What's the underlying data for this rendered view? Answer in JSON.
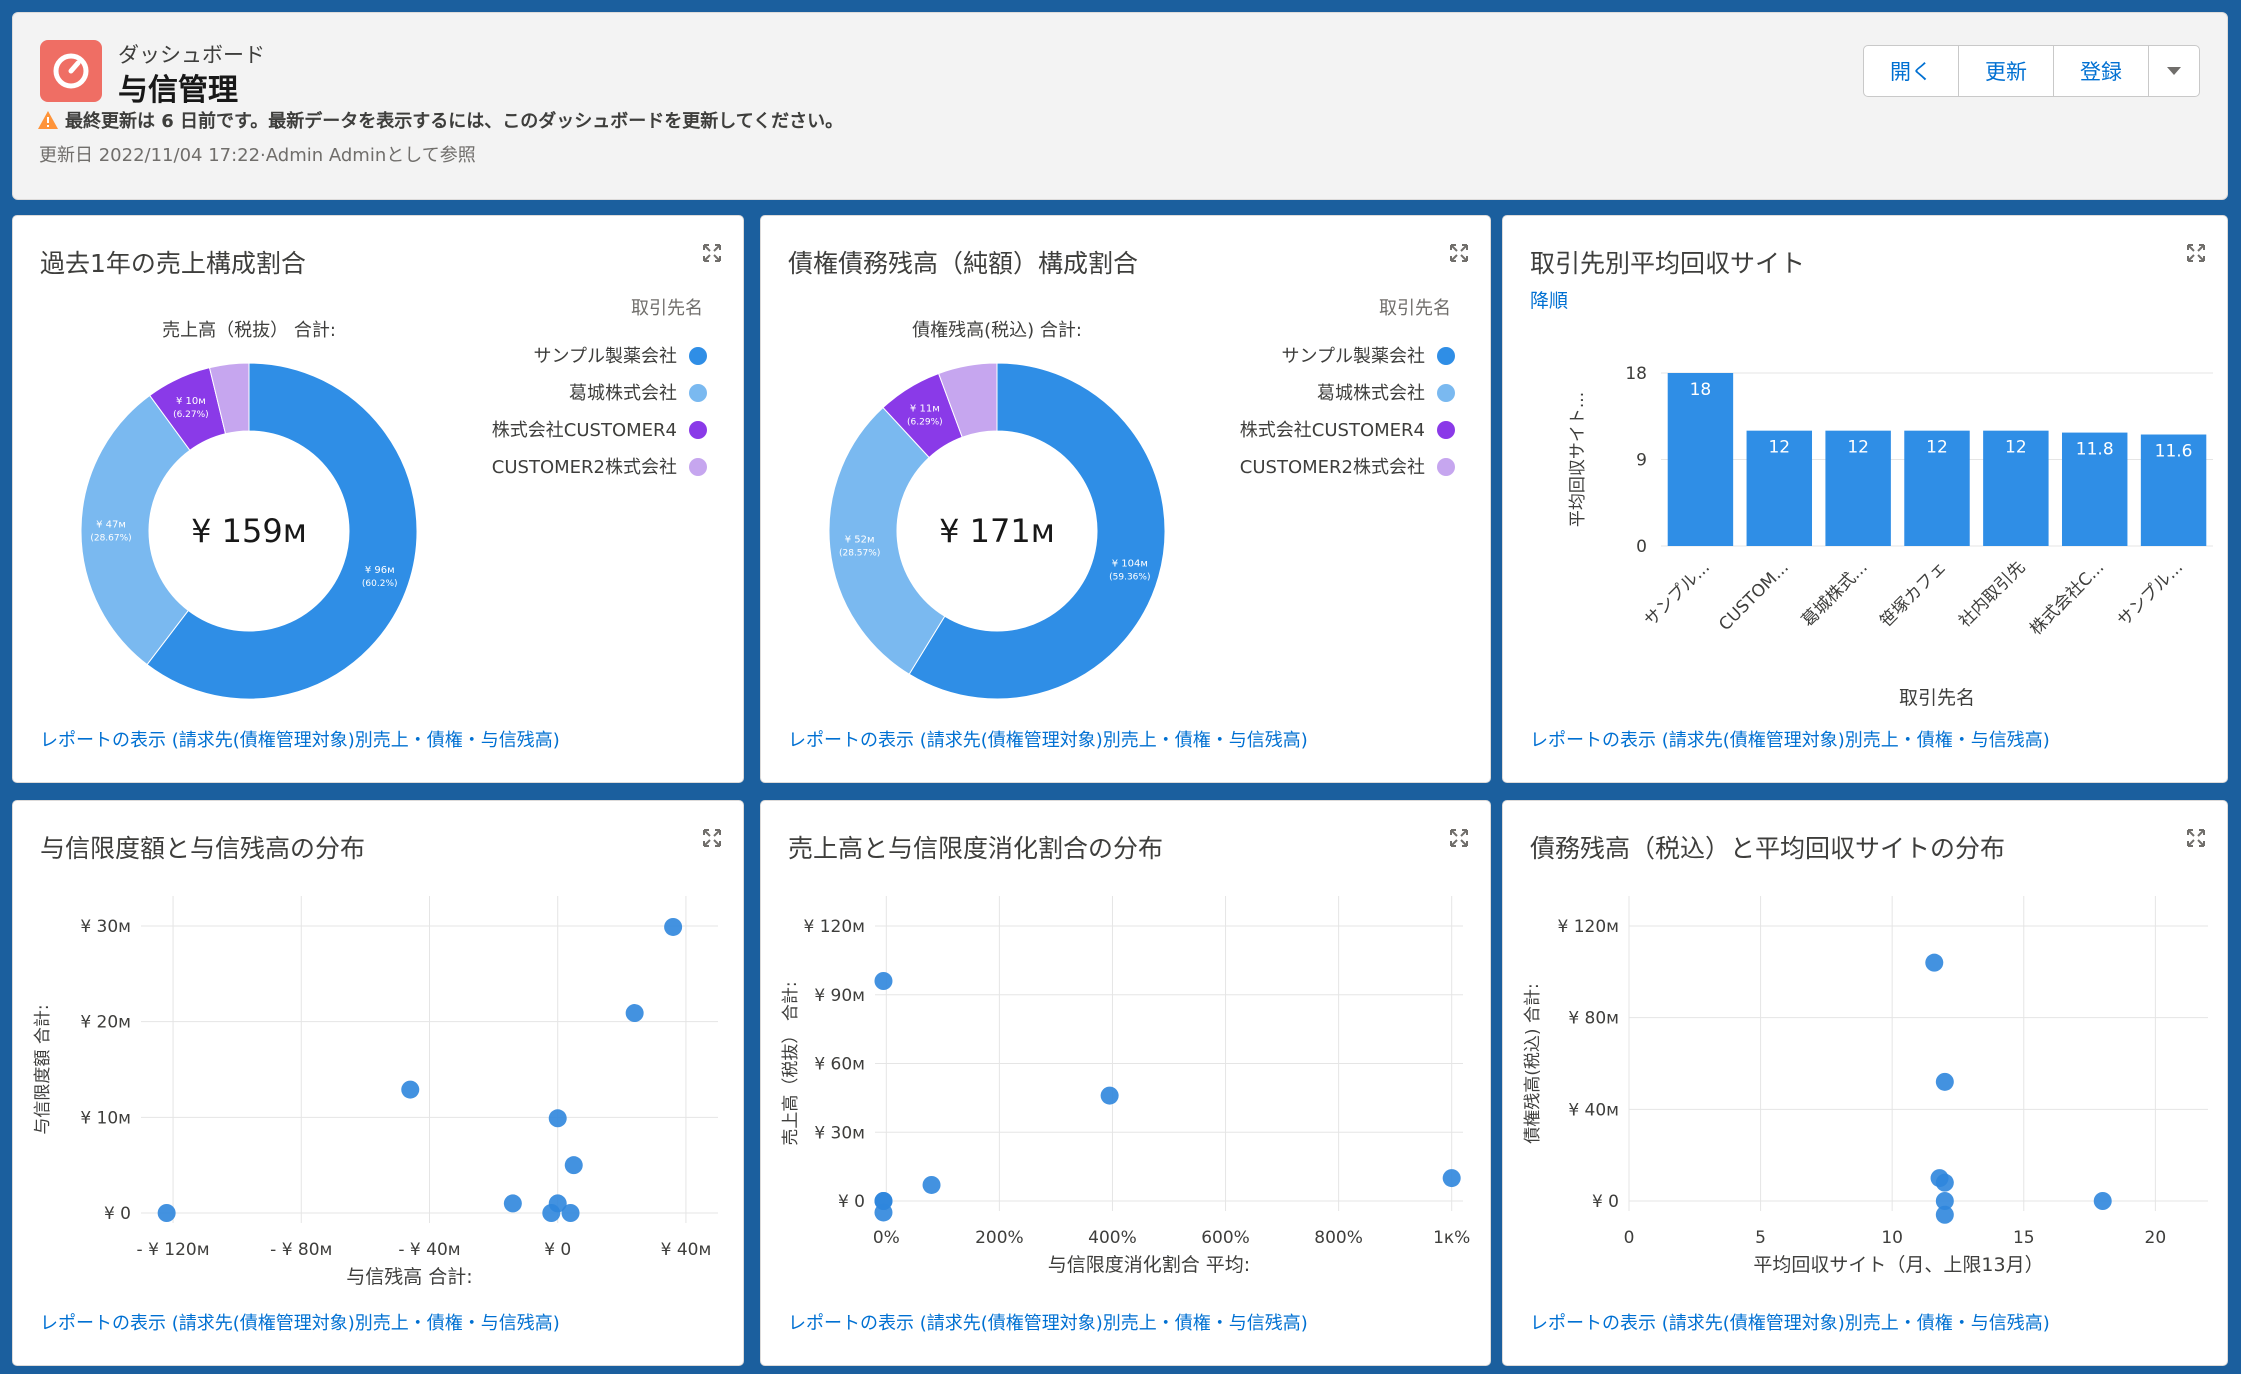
{
  "header": {
    "eyebrow": "ダッシュボード",
    "title": "与信管理",
    "warning": "最終更新は 6 日前です。最新データを表示するには、このダッシュボードを更新してください。",
    "updated": "更新日 2022/11/04 17:22·Admin Adminとして参照",
    "buttons": {
      "open": "開く",
      "refresh": "更新",
      "subscribe": "登録"
    }
  },
  "colors": {
    "c1": "#2f8ee6",
    "c2": "#7ab9f0",
    "c3": "#8a3ae8",
    "c4": "#c6a6ef",
    "bar": "#2f8ee6",
    "point": "#2f86dd",
    "link": "#0070d2"
  },
  "cards": {
    "c1": {
      "title": "過去1年の売上構成割合",
      "link": "レポートの表示 (請求先(債権管理対象)別売上・債権・与信残高)"
    },
    "c2": {
      "title": "債権債務残高（純額）構成割合",
      "link": "レポートの表示 (請求先(債権管理対象)別売上・債権・与信残高)"
    },
    "c3": {
      "title": "取引先別平均回収サイト",
      "subtitle": "降順",
      "link": "レポートの表示 (請求先(債権管理対象)別売上・債権・与信残高)"
    },
    "c4": {
      "title": "与信限度額と与信残高の分布",
      "link": "レポートの表示 (請求先(債権管理対象)別売上・債権・与信残高)"
    },
    "c5": {
      "title": "売上高と与信限度消化割合の分布",
      "link": "レポートの表示 (請求先(債権管理対象)別売上・債権・与信残高)"
    },
    "c6": {
      "title": "債務残高（税込）と平均回収サイトの分布",
      "link": "レポートの表示 (請求先(債権管理対象)別売上・債権・与信残高)"
    }
  },
  "chart_data": [
    {
      "type": "pie",
      "subtype": "donut",
      "measure": "売上高（税抜） 合計:",
      "center": "¥ 159м",
      "legend_title": "取引先名",
      "legend_placement": "right",
      "series": [
        {
          "name": "サンプル製薬会社",
          "value": 96,
          "label": "¥ 96м",
          "pct": "(60.2%)"
        },
        {
          "name": "葛城株式会社",
          "value": 47,
          "label": "¥ 47м",
          "pct": "(28.67%)"
        },
        {
          "name": "株式会社CUSTOMER4",
          "value": 10,
          "label": "¥ 10м",
          "pct": "(6.27%)"
        },
        {
          "name": "CUSTOMER2株式会社",
          "value": 6,
          "label": "",
          "pct": ""
        }
      ]
    },
    {
      "type": "pie",
      "subtype": "donut",
      "measure": "債権残高(税込) 合計:",
      "center": "¥ 171м",
      "legend_title": "取引先名",
      "legend_placement": "right",
      "series": [
        {
          "name": "サンプル製薬会社",
          "value": 104,
          "label": "¥ 104м",
          "pct": "(59.36%)"
        },
        {
          "name": "葛城株式会社",
          "value": 52,
          "label": "¥ 52м",
          "pct": "(28.57%)"
        },
        {
          "name": "株式会社CUSTOMER4",
          "value": 11,
          "label": "¥ 11м",
          "pct": "(6.29%)"
        },
        {
          "name": "CUSTOMER2株式会社",
          "value": 10,
          "label": "",
          "pct": ""
        }
      ]
    },
    {
      "type": "bar",
      "categories": [
        "サンプル...",
        "CUSTOM...",
        "葛城株式...",
        "笹塚カフェ",
        "社内取引先",
        "株式会社C...",
        "サンプル..."
      ],
      "values": [
        18,
        12,
        12,
        12,
        12,
        11.8,
        11.6
      ],
      "value_labels": [
        "18",
        "12",
        "12",
        "12",
        "12",
        "11.8",
        "11.6"
      ],
      "xlabel": "取引先名",
      "ylabel": "平均回収サイト...",
      "yticks": [
        "18",
        "9",
        "0"
      ],
      "ylim": [
        0,
        18
      ],
      "grid": true
    },
    {
      "type": "scatter",
      "xlabel": "与信残高 合計:",
      "ylabel": "与信限度額 合計:",
      "xlim": [
        -130,
        50
      ],
      "ylim": [
        0,
        30
      ],
      "xticks": [
        {
          "v": -120,
          "t": "- ¥ 120м"
        },
        {
          "v": -80,
          "t": "- ¥ 80м"
        },
        {
          "v": -40,
          "t": "- ¥ 40м"
        },
        {
          "v": 0,
          "t": "¥ 0"
        },
        {
          "v": 40,
          "t": "¥ 40м"
        }
      ],
      "yticks": [
        {
          "v": 0,
          "t": "¥ 0"
        },
        {
          "v": 10,
          "t": "¥ 10м"
        },
        {
          "v": 20,
          "t": "¥ 20м"
        },
        {
          "v": 30,
          "t": "¥ 30м"
        }
      ],
      "points": [
        [
          -122,
          0
        ],
        [
          -46,
          12.9
        ],
        [
          0,
          9.9
        ],
        [
          5,
          5
        ],
        [
          -14,
          1
        ],
        [
          0,
          1
        ],
        [
          -2,
          0
        ],
        [
          4,
          0
        ],
        [
          24,
          20.9
        ],
        [
          36,
          29.9
        ]
      ]
    },
    {
      "type": "scatter",
      "xlabel": "与信限度消化割合 平均:",
      "ylabel": "売上高（税抜） 合計:",
      "xlim": [
        -20,
        1020
      ],
      "ylim": [
        0,
        120
      ],
      "xticks": [
        {
          "v": 0,
          "t": "0%"
        },
        {
          "v": 200,
          "t": "200%"
        },
        {
          "v": 400,
          "t": "400%"
        },
        {
          "v": 600,
          "t": "600%"
        },
        {
          "v": 800,
          "t": "800%"
        },
        {
          "v": 1000,
          "t": "1к%"
        }
      ],
      "yticks": [
        {
          "v": 0,
          "t": "¥ 0"
        },
        {
          "v": 30,
          "t": "¥ 30м"
        },
        {
          "v": 60,
          "t": "¥ 60м"
        },
        {
          "v": 90,
          "t": "¥ 90м"
        },
        {
          "v": 120,
          "t": "¥ 120м"
        }
      ],
      "points": [
        [
          -5,
          96
        ],
        [
          -5,
          0
        ],
        [
          -5,
          -5
        ],
        [
          -5,
          0
        ],
        [
          80,
          7
        ],
        [
          395,
          46
        ],
        [
          1000,
          10
        ]
      ]
    },
    {
      "type": "scatter",
      "xlabel": "平均回収サイト（月、上限13月）",
      "ylabel": "債権残高(税込) 合計:",
      "xlim": [
        0,
        22
      ],
      "ylim": [
        0,
        120
      ],
      "xticks": [
        {
          "v": 0,
          "t": "0"
        },
        {
          "v": 5,
          "t": "5"
        },
        {
          "v": 10,
          "t": "10"
        },
        {
          "v": 15,
          "t": "15"
        },
        {
          "v": 20,
          "t": "20"
        }
      ],
      "yticks": [
        {
          "v": 0,
          "t": "¥ 0"
        },
        {
          "v": 40,
          "t": "¥ 40м"
        },
        {
          "v": 80,
          "t": "¥ 80м"
        },
        {
          "v": 120,
          "t": "¥ 120м"
        }
      ],
      "points": [
        [
          11.6,
          104
        ],
        [
          12,
          52
        ],
        [
          11.8,
          10
        ],
        [
          12,
          8
        ],
        [
          12,
          0
        ],
        [
          12,
          -6
        ],
        [
          18,
          0
        ]
      ]
    }
  ]
}
